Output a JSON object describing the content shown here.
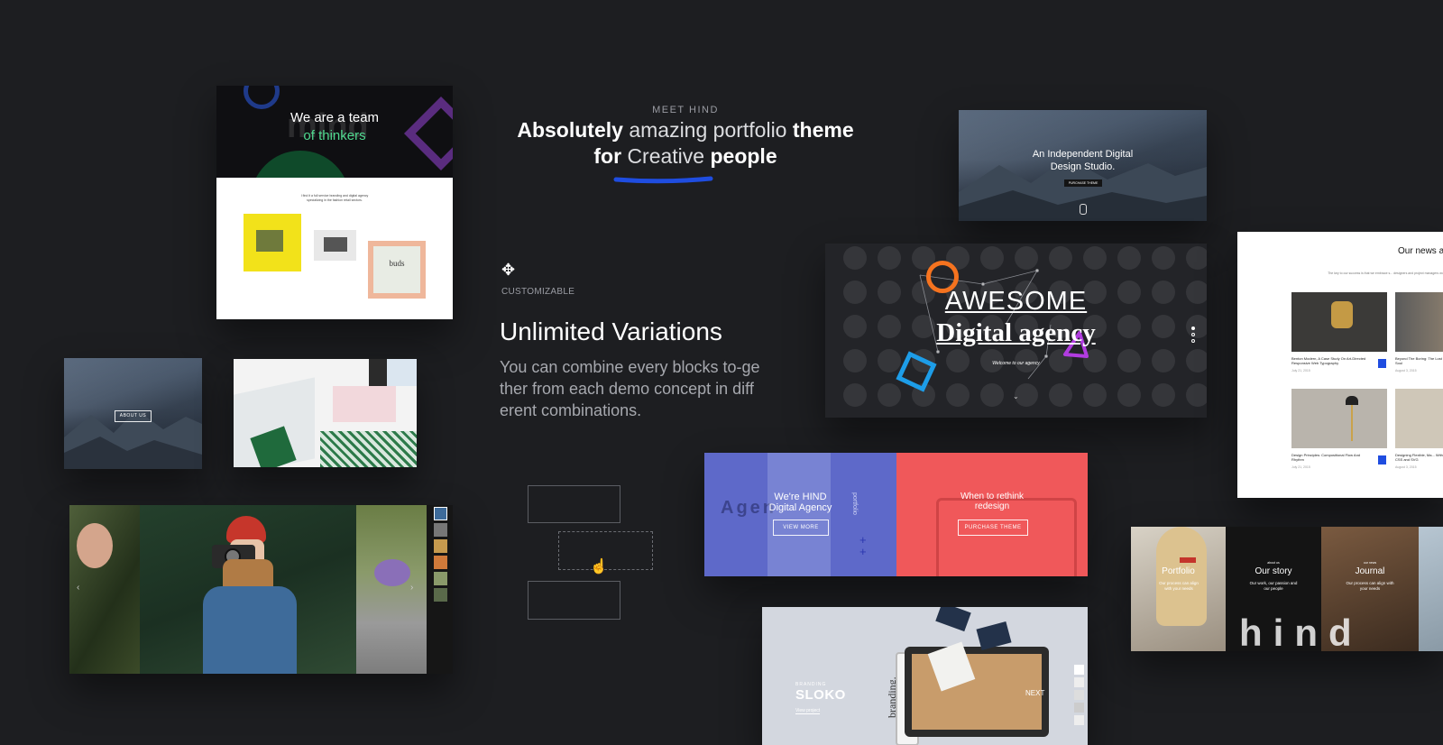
{
  "hero": {
    "eyebrow": "MEET HIND",
    "line1_bold_a": "Absolutely",
    "line1_light": "amazing portfolio",
    "line1_bold_b": "theme",
    "line2_bold_a": "for",
    "line2_light": "Creative",
    "line2_bold_b": "people"
  },
  "feature": {
    "label": "CUSTOMIZABLE",
    "title": "Unlimited Variations",
    "body": "You can combine every blocks to-gether from each demo concept in different combinations."
  },
  "demo_team": {
    "line1": "We are a team",
    "line2": "of thinkers",
    "watermark": "mind",
    "caption": "I find it a full service branding and digital agency specializing in the fashion retail sectors.",
    "frame_text": "buds"
  },
  "demo_about": {
    "button": "ABOUT US"
  },
  "demo_independent": {
    "line1": "An Independent Digital",
    "line2": "Design Studio.",
    "button": "PURCHASE THEME"
  },
  "demo_awesome": {
    "line1": "AWESOME",
    "line2": "Digital agency",
    "sub": "Welcome to our agency"
  },
  "demo_hind_blue": {
    "line1": "We're HIND",
    "line2": "Digital Agency",
    "button": "VIEW MORE",
    "side": "portfolio",
    "bg_text": "Agen"
  },
  "demo_rethink": {
    "line1": "When to rethink",
    "line2": "redesign",
    "button": "PURCHASE THEME"
  },
  "demo_news": {
    "title": "Our news a",
    "sub": "The key to our success is that we embrace s... designers and project managers work closely and direct...",
    "items": [
      {
        "caption": "Benton Modern, A Case Study On Art-Directed Responsive Web Typography",
        "date": "July 21, 2015"
      },
      {
        "caption": "Beyond The Boring: The Lost Soul",
        "date": "August 3, 2015"
      },
      {
        "caption": "Design Principles: Compositional Flow And Rhythm",
        "date": "July 21, 2015"
      },
      {
        "caption": "Designing Flexible, Ma... With CSS and SVG",
        "date": "August 3, 2015"
      }
    ]
  },
  "demo_tiles": {
    "tiles": [
      {
        "small": "",
        "title": "Portfolio",
        "text": "Our process can align with your needs"
      },
      {
        "small": "about us",
        "title": "Our story",
        "text": "Our work, our passion and our people"
      },
      {
        "small": "our news",
        "title": "Journal",
        "text": "Our process can align with your needs"
      }
    ],
    "watermark": "hind"
  },
  "demo_sloko": {
    "label": "BRANDING",
    "title": "SLOKO",
    "link": "View project",
    "next": "NEXT",
    "side": "branding."
  },
  "colors": {
    "bg": "#1d1e21",
    "blue_accent": "#1f4de0",
    "orange": "#f5731f",
    "purple_panel": "#5e69c9",
    "red_panel": "#f0585a",
    "green_text": "#4fd98f"
  }
}
